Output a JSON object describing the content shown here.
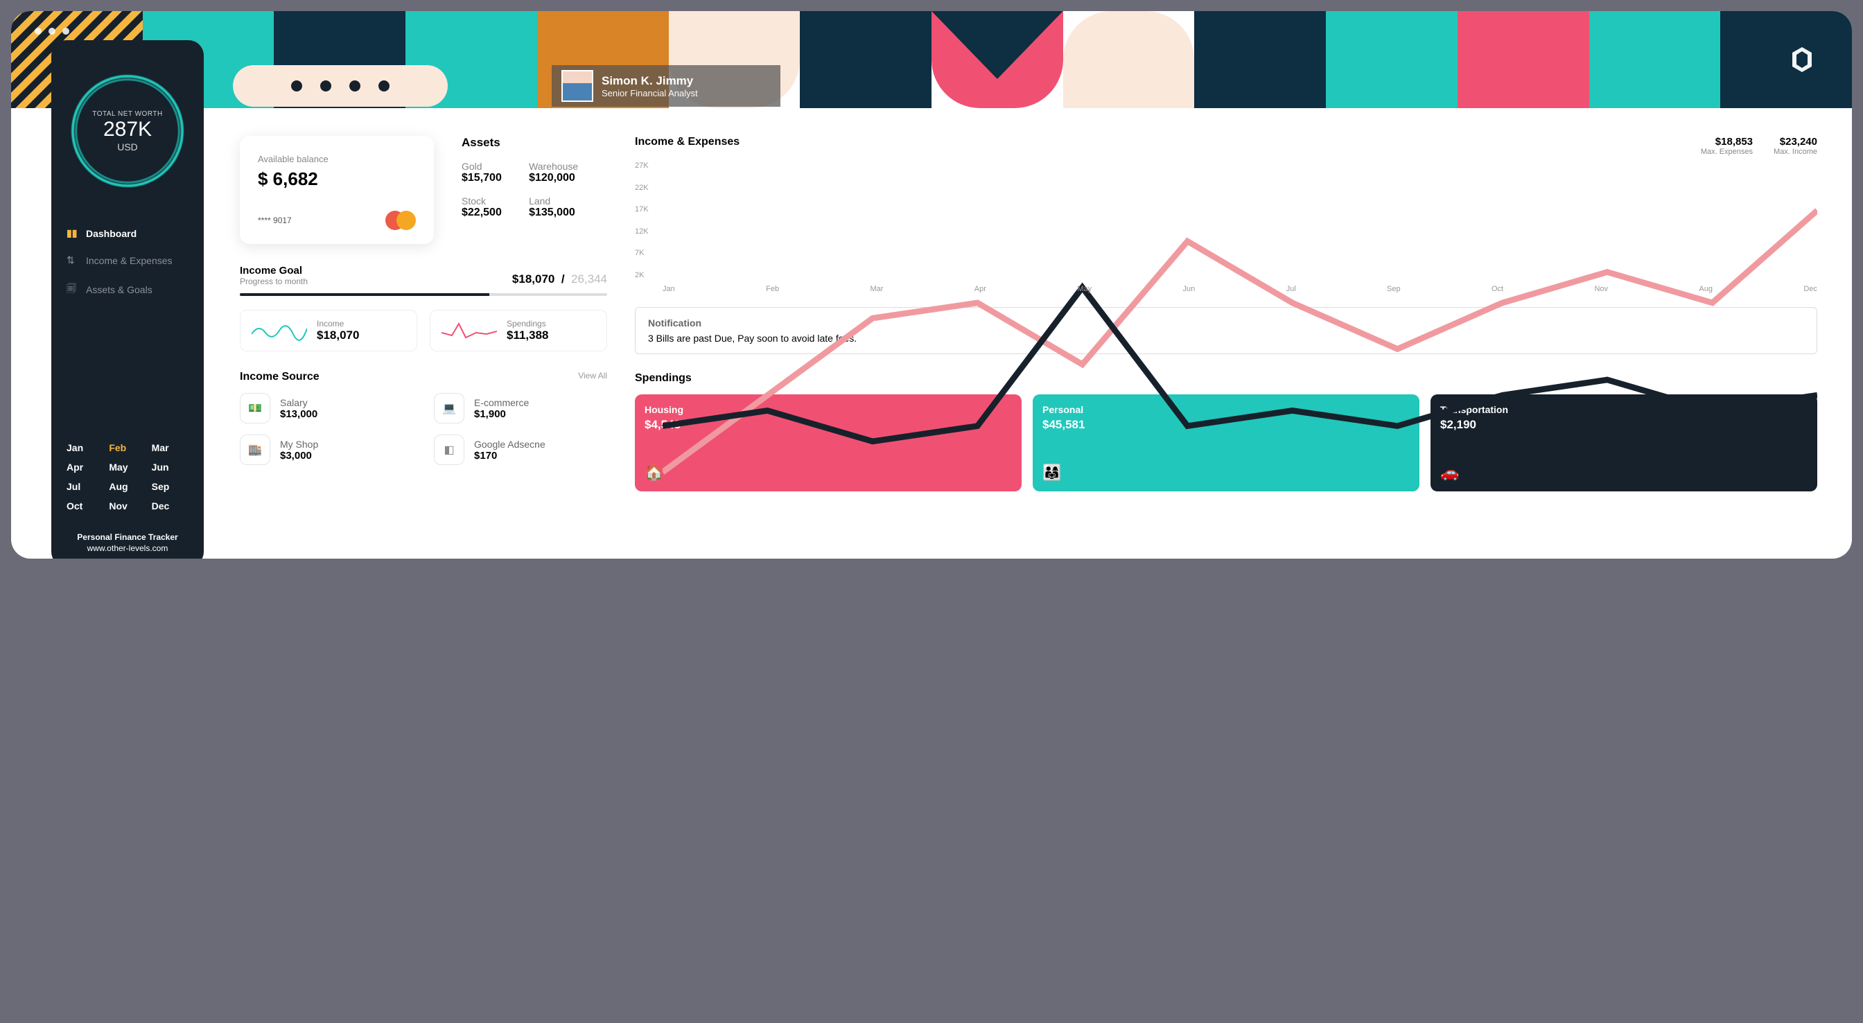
{
  "profile": {
    "name": "Simon K. Jimmy",
    "role": "Senior Financial Analyst"
  },
  "sidebar": {
    "networth": {
      "label": "TOTAL NET WORTH",
      "value": "287K",
      "unit": "USD"
    },
    "nav": [
      {
        "label": "Dashboard",
        "active": true
      },
      {
        "label": "Income & Expenses",
        "active": false
      },
      {
        "label": "Assets & Goals",
        "active": false
      }
    ],
    "months": [
      "Jan",
      "Feb",
      "Mar",
      "Apr",
      "May",
      "Jun",
      "Jul",
      "Aug",
      "Sep",
      "Oct",
      "Nov",
      "Dec"
    ],
    "selected_month": "Feb",
    "footer_title": "Personal Finance Tracker",
    "footer_sub": "www.other-levels.com"
  },
  "balance": {
    "label": "Available balance",
    "amount": "$ 6,682",
    "card_last4": "**** 9017"
  },
  "assets": {
    "title": "Assets",
    "items": [
      {
        "name": "Gold",
        "value": "$15,700"
      },
      {
        "name": "Warehouse",
        "value": "$120,000"
      },
      {
        "name": "Stock",
        "value": "$22,500"
      },
      {
        "name": "Land",
        "value": "$135,000"
      }
    ]
  },
  "goal": {
    "title": "Income Goal",
    "sub": "Progress to month",
    "current": "$18,070",
    "target": "26,344"
  },
  "mini": {
    "income": {
      "label": "Income",
      "value": "$18,070"
    },
    "spendings": {
      "label": "Spendings",
      "value": "$11,388"
    }
  },
  "sources": {
    "title": "Income Source",
    "view_all": "View All",
    "items": [
      {
        "name": "Salary",
        "value": "$13,000",
        "icon": "cash-icon"
      },
      {
        "name": "E-commerce",
        "value": "$1,900",
        "icon": "laptop-icon"
      },
      {
        "name": "My Shop",
        "value": "$3,000",
        "icon": "shop-icon"
      },
      {
        "name": "Google Adsecne",
        "value": "$170",
        "icon": "ads-icon"
      }
    ]
  },
  "chart": {
    "title": "Income & Expenses",
    "max_expenses": {
      "value": "$18,853",
      "label": "Max. Expenses"
    },
    "max_income": {
      "value": "$23,240",
      "label": "Max. Income"
    }
  },
  "chart_data": {
    "type": "line",
    "categories": [
      "Jan",
      "Feb",
      "Mar",
      "Apr",
      "May",
      "Jun",
      "Jul",
      "Sep",
      "Oct",
      "Nov",
      "Aug",
      "Dec"
    ],
    "y_ticks": [
      "27K",
      "22K",
      "17K",
      "12K",
      "7K",
      "2K"
    ],
    "ylim": [
      2,
      27
    ],
    "series": [
      {
        "name": "Income",
        "color": "#f09aa0",
        "values": [
          7,
          12,
          17,
          18,
          14,
          22,
          18,
          15,
          18,
          20,
          18,
          24
        ]
      },
      {
        "name": "Expenses",
        "color": "#17212b",
        "values": [
          10,
          11,
          9,
          10,
          19,
          10,
          11,
          10,
          12,
          13,
          11,
          12
        ]
      }
    ]
  },
  "notification": {
    "title": "Notification",
    "body": "3 Bills are past Due, Pay soon to avoid late fees."
  },
  "spendings": {
    "title": "Spendings",
    "cards": [
      {
        "name": "Housing",
        "value": "$4,548",
        "class": "sc-pink",
        "icon": "home-icon"
      },
      {
        "name": "Personal",
        "value": "$45,581",
        "class": "sc-teal",
        "icon": "family-icon"
      },
      {
        "name": "Transportation",
        "value": "$2,190",
        "class": "sc-dark",
        "icon": "car-icon"
      }
    ]
  }
}
